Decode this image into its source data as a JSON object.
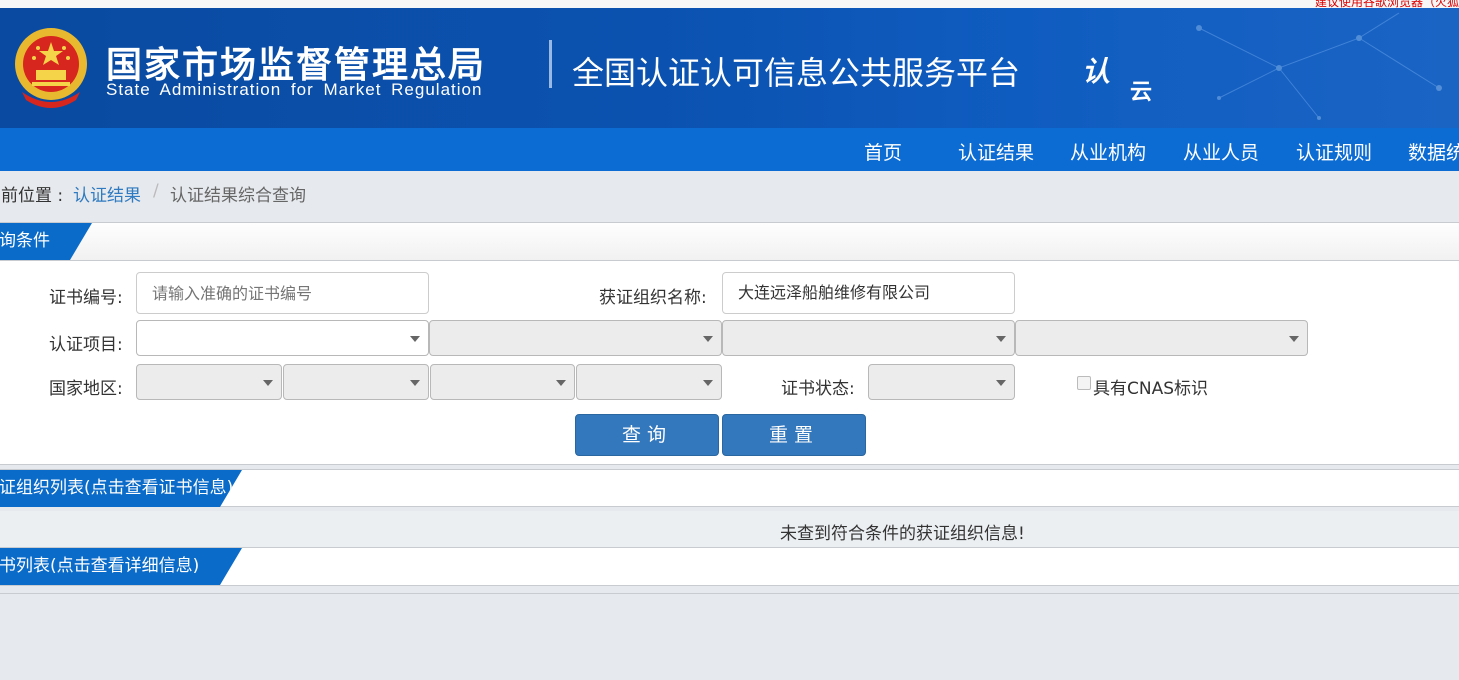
{
  "top_note": "建议使用谷歌浏览器（火狐",
  "header": {
    "org_cn": "国家市场监督管理总局",
    "org_en": "State Administration for Market Regulation",
    "platform": "全国认证认可信息公共服务平台",
    "logo_r": "认",
    "logo_y": "云"
  },
  "nav": [
    "首页",
    "认证结果",
    "从业机构",
    "从业人员",
    "认证规则",
    "数据统"
  ],
  "breadcrumb": {
    "lead": "当前位置 :",
    "link": "认证结果",
    "sep": "/",
    "current": "认证结果综合查询"
  },
  "query": {
    "section_title": "查询条件",
    "cert_no_label": "证书编号:",
    "cert_no_placeholder": "请输入准确的证书编号",
    "org_name_label": "获证组织名称:",
    "org_name_value": "大连远泽船舶维修有限公司",
    "project_label": "认证项目:",
    "region_label": "国家地区:",
    "status_label": "证书状态:",
    "cnas_label": "具有CNAS标识",
    "search_btn": "查询",
    "reset_btn": "重置"
  },
  "org_list": {
    "title": "获证组织列表(点击查看证书信息)",
    "empty": "未查到符合条件的获证组织信息!"
  },
  "cert_list": {
    "title": "证书列表(点击查看详细信息)"
  },
  "colors": {
    "header_blue": "#0b52b0",
    "nav_blue": "#0c6cd4",
    "button_blue": "#3378bd",
    "link_blue": "#2f7ac0"
  }
}
